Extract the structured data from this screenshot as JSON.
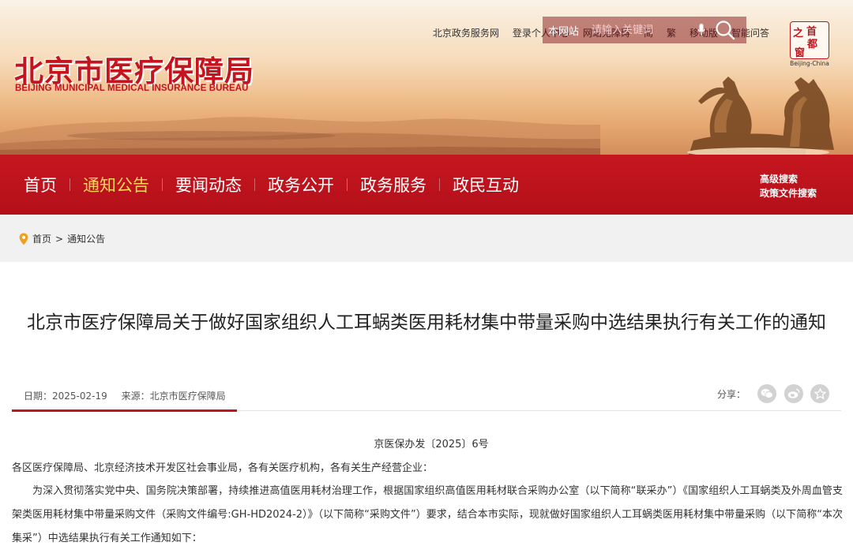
{
  "header": {
    "logo_cn": "北京市医疗保障局",
    "logo_en": "BEIJING MUNICIPAL MEDICAL INSURANCE BUREAU",
    "top_links": [
      "北京政务服务网",
      "登录个人中心",
      "网站无障碍",
      "简",
      "繁",
      "移动版",
      "智能问答"
    ],
    "seal_chars": [
      "之",
      "首",
      "都",
      "窗"
    ],
    "seal_en": "Beijing-China"
  },
  "nav": {
    "items": [
      "首页",
      "通知公告",
      "要闻动态",
      "政务公开",
      "政务服务",
      "政民互动"
    ],
    "active_index": 1,
    "active_color": "#ffd35c",
    "bar_color": "#c5161f",
    "search_scope": "本网站",
    "search_placeholder": "请输入关键词",
    "adv_search": "高级搜索",
    "policy_search": "政策文件搜索"
  },
  "breadcrumb": {
    "home": "首页",
    "separator": ">",
    "current": "通知公告"
  },
  "article": {
    "title": "北京市医疗保障局关于做好国家组织人工耳蜗类医用耗材集中带量采购中选结果执行有关工作的通知",
    "date": "日期：2025-02-19",
    "source": "来源：北京市医疗保障局",
    "share_label": "分享：",
    "share_icons": [
      "wechat-icon",
      "weibo-icon",
      "favorite-icon"
    ],
    "doc_number": "京医保办发〔2025〕6号",
    "salutation": "各区医疗保障局、北京经济技术开发区社会事业局，各有关医疗机构，各有关生产经营企业：",
    "body": "为深入贯彻落实党中央、国务院决策部署，持续推进高值医用耗材治理工作，根据国家组织高值医用耗材联合采购办公室（以下简称“联采办”）《国家组织人工耳蜗类及外周血管支架类医用耗材集中带量采购文件（采购文件编号:GH-HD2024-2）》（以下简称“采购文件”）要求，结合本市实际，现就做好国家组织人工耳蜗类医用耗材集中带量采购（以下简称“本次集采”）中选结果执行有关工作通知如下："
  }
}
